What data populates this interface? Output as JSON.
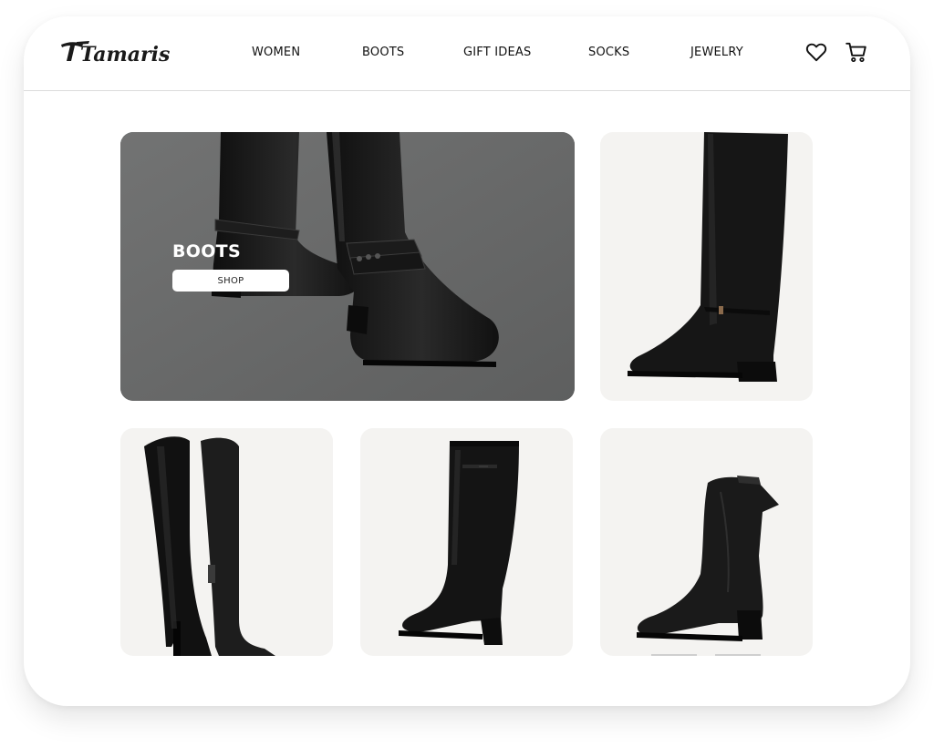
{
  "header": {
    "brand": "Tamaris",
    "nav": [
      {
        "label": "WOMEN"
      },
      {
        "label": "BOOTS"
      },
      {
        "label": "GIFT IDEAS"
      },
      {
        "label": "SOCKS"
      },
      {
        "label": "JEWELRY"
      }
    ],
    "icons": [
      "heart-icon",
      "cart-icon"
    ]
  },
  "hero": {
    "title": "BOOTS",
    "button_label": "SHOP"
  },
  "products": [
    {
      "image": "knee-high-boot-with-buckle-strap"
    },
    {
      "image": "over-the-knee-boot-pair"
    },
    {
      "image": "block-heel-knee-boot"
    },
    {
      "image": "western-ankle-boot"
    }
  ],
  "colors": {
    "hero_background": "#6a6b6b",
    "card_background": "#f4f3f1",
    "boot": "#141414"
  }
}
